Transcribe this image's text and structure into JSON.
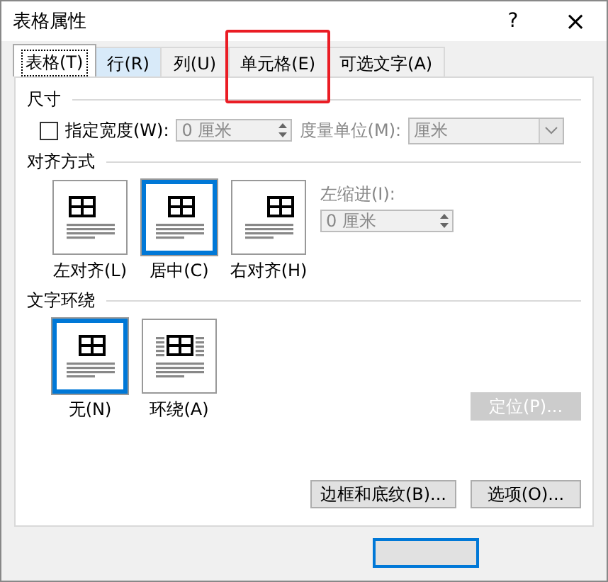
{
  "window": {
    "title": "表格属性",
    "help": "?",
    "close": "×"
  },
  "tabs": [
    {
      "label": "表格(T)",
      "selected": true,
      "hovered": false,
      "annotated": false
    },
    {
      "label": "行(R)",
      "selected": false,
      "hovered": true,
      "annotated": false
    },
    {
      "label": "列(U)",
      "selected": false,
      "hovered": false,
      "annotated": false
    },
    {
      "label": "单元格(E)",
      "selected": false,
      "hovered": false,
      "annotated": true
    },
    {
      "label": "可选文字(A)",
      "selected": false,
      "hovered": false,
      "annotated": false
    }
  ],
  "size": {
    "title": "尺寸",
    "preferred_width": {
      "label": "指定宽度(W):",
      "checked": false,
      "value": "0 厘米",
      "disabled": true
    },
    "unit": {
      "label": "度量单位(M):",
      "value": "厘米",
      "disabled": true
    }
  },
  "alignment": {
    "title": "对齐方式",
    "options": [
      {
        "label": "左对齐(L)",
        "kind": "left",
        "selected": false
      },
      {
        "label": "居中(C)",
        "kind": "center",
        "selected": true
      },
      {
        "label": "右对齐(H)",
        "kind": "right",
        "selected": false
      }
    ],
    "indent": {
      "label": "左缩进(I):",
      "value": "0 厘米",
      "disabled": true
    }
  },
  "wrapping": {
    "title": "文字环绕",
    "options": [
      {
        "label": "无(N)",
        "kind": "none",
        "selected": true
      },
      {
        "label": "环绕(A)",
        "kind": "around",
        "selected": false
      }
    ],
    "position_button": {
      "label": "定位(P)...",
      "disabled": true
    }
  },
  "buttons": [
    {
      "label": "边框和底纹(B)..."
    },
    {
      "label": "选项(O)..."
    }
  ],
  "footer_buttons": [
    {
      "focused": true
    }
  ]
}
